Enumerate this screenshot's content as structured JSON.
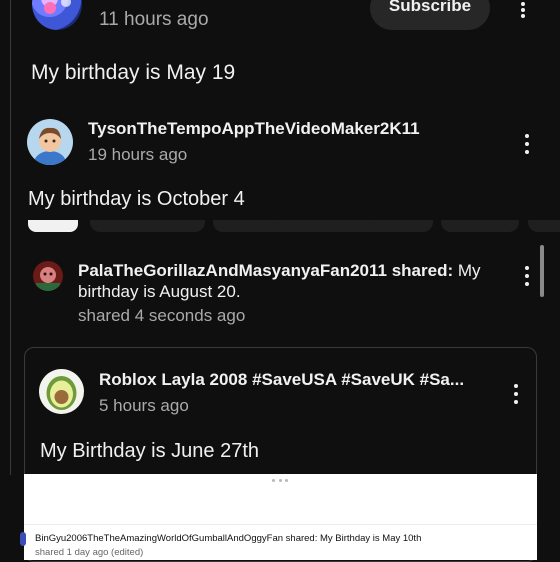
{
  "post1": {
    "time": "11 hours ago",
    "subscribe_label": "Subscribe",
    "body": "My birthday is May 19"
  },
  "post2": {
    "author": "TysonTheTempoAppTheVideoMaker2K11",
    "time": "19 hours ago",
    "body": "My birthday is October 4"
  },
  "post3": {
    "author": "PalaTheGorillazAndMasyanyaFan2011",
    "shared_word": "shared:",
    "body_start": "My",
    "body_rest": "birthday is August 20.",
    "time": "shared 4 seconds ago"
  },
  "post4": {
    "author": "Roblox Layla 2008 #SaveUSA #SaveUK #Sa...",
    "time": "5 hours ago",
    "body": "My Birthday is June 27th"
  },
  "post5": {
    "author": "BinGyu2006TheTheAmazingWorldOfGumballAndOggyFan",
    "shared_word": "shared:",
    "body": "My Birthday is May 10th",
    "time": "shared 1 day ago (edited)"
  },
  "icons": {
    "more": "more-vert-icon",
    "drag": "drag-handle-icon"
  },
  "colors": {
    "background": "#0f0f0f",
    "card_border": "#3a3a3a",
    "subscribe_bg": "#272727",
    "muted_text": "#aaaaaa"
  }
}
